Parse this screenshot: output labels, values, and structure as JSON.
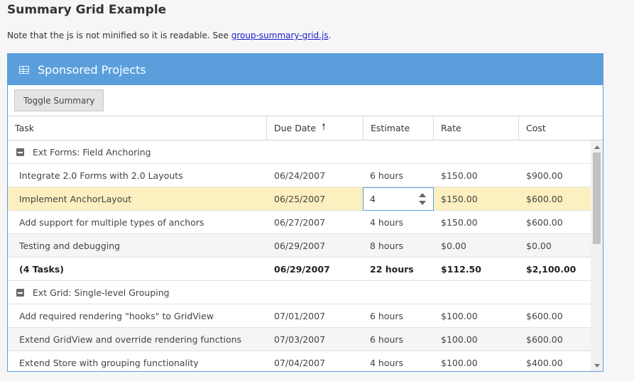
{
  "page": {
    "title": "Summary Grid Example",
    "note_text": "Note that the js is not minified so it is readable. See ",
    "note_link": "group-summary-grid.js",
    "note_end": "."
  },
  "panel": {
    "title": "Sponsored Projects",
    "icon": "grid-icon",
    "toggle_button": "Toggle Summary"
  },
  "columns": [
    {
      "label": "Task"
    },
    {
      "label": "Due Date",
      "sort": "ascending",
      "sort_glyph": "🠕"
    },
    {
      "label": "Estimate"
    },
    {
      "label": "Rate"
    },
    {
      "label": "Cost"
    }
  ],
  "editor": {
    "value": "4"
  },
  "rows": [
    {
      "type": "group",
      "label": "Ext Forms: Field Anchoring"
    },
    {
      "type": "data",
      "task": "Integrate 2.0 Forms with 2.0 Layouts",
      "due": "06/24/2007",
      "estimate": "6 hours",
      "rate": "$150.00",
      "cost": "$900.00"
    },
    {
      "type": "data",
      "task": "Implement AnchorLayout",
      "due": "06/25/2007",
      "estimate": "4",
      "rate": "$150.00",
      "cost": "$600.00",
      "selected": true
    },
    {
      "type": "data",
      "task": "Add support for multiple types of anchors",
      "due": "06/27/2007",
      "estimate": "4 hours",
      "rate": "$150.00",
      "cost": "$600.00"
    },
    {
      "type": "data",
      "task": "Testing and debugging",
      "due": "06/29/2007",
      "estimate": "8 hours",
      "rate": "$0.00",
      "cost": "$0.00"
    },
    {
      "type": "summary",
      "task": "(4 Tasks)",
      "due": "06/29/2007",
      "estimate": "22 hours",
      "rate": "$112.50",
      "cost": "$2,100.00"
    },
    {
      "type": "group",
      "label": "Ext Grid: Single-level Grouping"
    },
    {
      "type": "data",
      "task": "Add required rendering \"hooks\" to GridView",
      "due": "07/01/2007",
      "estimate": "6 hours",
      "rate": "$100.00",
      "cost": "$600.00"
    },
    {
      "type": "data",
      "task": "Extend GridView and override rendering functions",
      "due": "07/03/2007",
      "estimate": "6 hours",
      "rate": "$100.00",
      "cost": "$600.00"
    },
    {
      "type": "data",
      "task": "Extend Store with grouping functionality",
      "due": "07/04/2007",
      "estimate": "4 hours",
      "rate": "$100.00",
      "cost": "$400.00"
    }
  ]
}
